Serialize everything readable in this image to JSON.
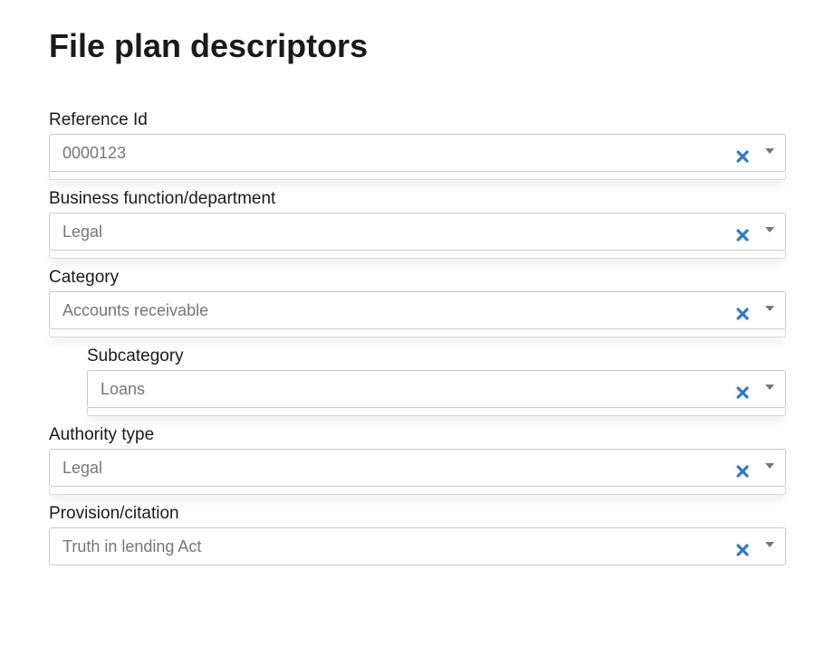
{
  "title": "File plan descriptors",
  "fields": {
    "referenceId": {
      "label": "Reference Id",
      "value": "0000123"
    },
    "businessFunction": {
      "label": "Business function/department",
      "value": "Legal"
    },
    "category": {
      "label": "Category",
      "value": "Accounts receivable"
    },
    "subcategory": {
      "label": "Subcategory",
      "value": "Loans"
    },
    "authorityType": {
      "label": "Authority type",
      "value": "Legal"
    },
    "provision": {
      "label": "Provision/citation",
      "value": "Truth in lending Act"
    }
  },
  "colors": {
    "clearIcon": "#3179c6"
  }
}
